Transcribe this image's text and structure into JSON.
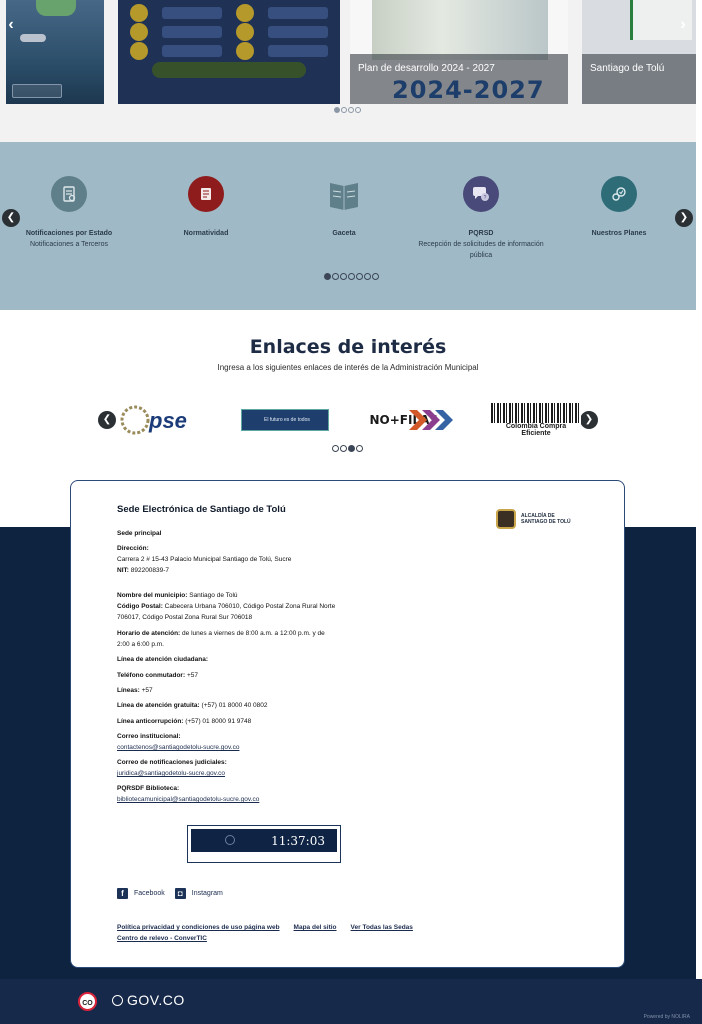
{
  "news": {
    "cards": [
      {
        "caption": ""
      },
      {
        "caption": ""
      },
      {
        "caption": "Plan de desarrollo 2024 - 2027",
        "banner": "2024-2027"
      },
      {
        "caption": "Santiago de Tolú"
      }
    ],
    "prev_icon": "chevron-left-icon",
    "next_icon": "chevron-right-icon"
  },
  "services": {
    "items": [
      {
        "title": "Notificaciones por Estado",
        "subtitle": "Notificaciones a Terceros",
        "icon": "notification-document-icon"
      },
      {
        "title": "Normatividad",
        "subtitle": "",
        "icon": "regulations-book-icon"
      },
      {
        "title": "Gaceta",
        "subtitle": "",
        "icon": "gazette-book-icon"
      },
      {
        "title": "PQRSD",
        "subtitle": "Recepción de solicitudes de información pública",
        "icon": "chat-bubbles-icon"
      },
      {
        "title": "Nuestros Planes",
        "subtitle": "",
        "icon": "plans-gear-icon"
      }
    ],
    "colors": {
      "band": "#9fbac6",
      "icon_gray": "#5f7f8a",
      "icon_red": "#8e1c1c",
      "icon_purple": "#4a4a7a",
      "icon_teal": "#2e6d78"
    }
  },
  "enlaces": {
    "title": "Enlaces de interés",
    "subtitle": "Ingresa a los siguientes enlaces de interés de la Administración Municipal",
    "logos": [
      {
        "label": "pse"
      },
      {
        "label": "El futuro es de todos"
      },
      {
        "label": "NO+FILAS"
      },
      {
        "label": "Colombia Compra Eficiente"
      }
    ]
  },
  "footer": {
    "title": "Sede Electrónica de Santiago de Tolú",
    "sede_label": "Sede principal",
    "direccion_label": "Dirección:",
    "direccion": "Carrera 2 # 15-43 Palacio Municipal Santiago de Tolú, Sucre",
    "nit_label": "NIT:",
    "nit": "892200839-7",
    "municipio_label": "Nombre del municipio:",
    "municipio": "Santiago de Tolú",
    "postal_label": "Código Postal:",
    "postal": "Cabecera Urbana 706010, Código Postal Zona Rural Norte 706017, Código Postal Zona Rural Sur 706018",
    "horario_label": "Horario de atención:",
    "horario": "de lunes a viernes de 8:00 a.m. a 12:00 p.m. y de 2:00 a 6:00 p.m.",
    "linea_ciudadana_label": "Línea de atención ciudadana:",
    "conmutador_label": "Teléfono conmutador:",
    "conmutador": "+57",
    "lineas_label": "Líneas:",
    "lineas": "+57",
    "gratuita_label": "Línea de atención gratuita:",
    "gratuita": "(+57) 01 8000 40 0802",
    "anticorrupcion_label": "Línea anticorrupción:",
    "anticorrupcion": "(+57) 01 8000 91 9748",
    "correo_label": "Correo institucional:",
    "correo": "contactenos@santiagodetolu-sucre.gov.co",
    "judicial_label": "Correo de notificaciones judiciales:",
    "judicial": "juridica@santiagodetolu-sucre.gov.co",
    "biblioteca_label": "PQRSDF Biblioteca:",
    "biblioteca": "bibliotecamunicipal@santiagodetolu-sucre.gov.co",
    "alcaldia_logo": "ALCALDÍA DE SANTIAGO DE TOLÚ",
    "clock": "11:37:03",
    "facebook": "Facebook",
    "instagram": "Instagram",
    "links": [
      "Política privacidad y condiciones de uso página web",
      "Mapa del sitio",
      "Ver Todas las Sedas",
      "Centro de relevo - ConverTIC"
    ]
  },
  "bottom": {
    "co_logo": "CO",
    "gov": "GOV.CO",
    "powered": "Powered by NOLIRA"
  }
}
